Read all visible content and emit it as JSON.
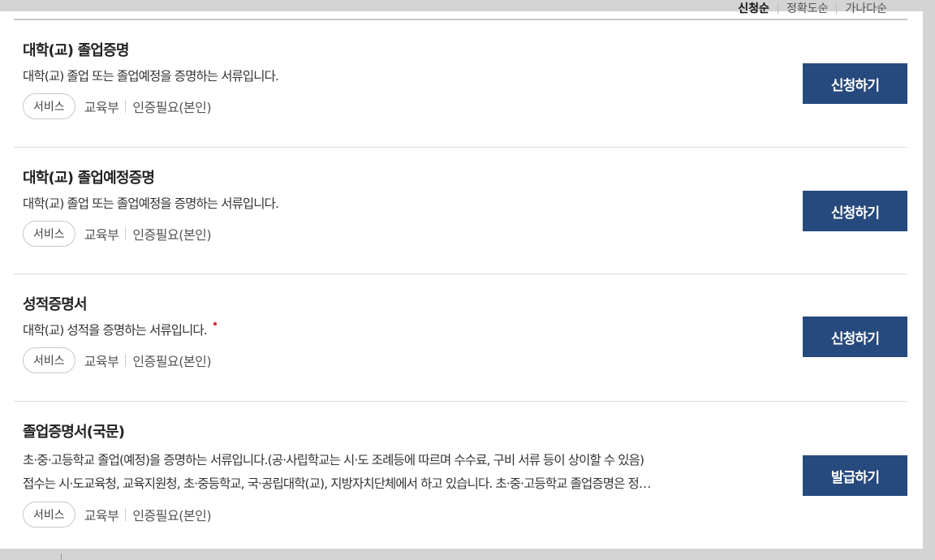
{
  "sort": {
    "options": [
      "신청순",
      "정확도순",
      "가나다순"
    ]
  },
  "documents": [
    {
      "title": "대학(교) 졸업증명",
      "desc_lines": [
        "대학(교) 졸업 또는 졸업예정을 증명하는 서류입니다."
      ],
      "tag": "서비스",
      "org": "교육부",
      "auth": "인증필요(본인)",
      "button": "신청하기"
    },
    {
      "title": "대학(교) 졸업예정증명",
      "desc_lines": [
        "대학(교) 졸업 또는 졸업예정을 증명하는 서류입니다."
      ],
      "tag": "서비스",
      "org": "교육부",
      "auth": "인증필요(본인)",
      "button": "신청하기"
    },
    {
      "title": "성적증명서",
      "desc_lines": [
        "대학(교) 성적을 증명하는 서류입니다."
      ],
      "tag": "서비스",
      "org": "교육부",
      "auth": "인증필요(본인)",
      "button": "신청하기"
    },
    {
      "title": "졸업증명서(국문)",
      "desc_lines": [
        "초·중·고등학교 졸업(예정)을 증명하는 서류입니다.(공·사립학교는 시·도 조례등에 따르며 수수료, 구비 서류 등이 상이할 수 있음)",
        "접수는 시·도교육청, 교육지원청, 초·중등학교, 국·공립대학(교), 지방자치단체에서 하고 있습니다. 초·중·고등학교 졸업증명은 정…"
      ],
      "tag": "서비스",
      "org": "교육부",
      "auth": "인증필요(본인)",
      "button": "발급하기"
    }
  ]
}
